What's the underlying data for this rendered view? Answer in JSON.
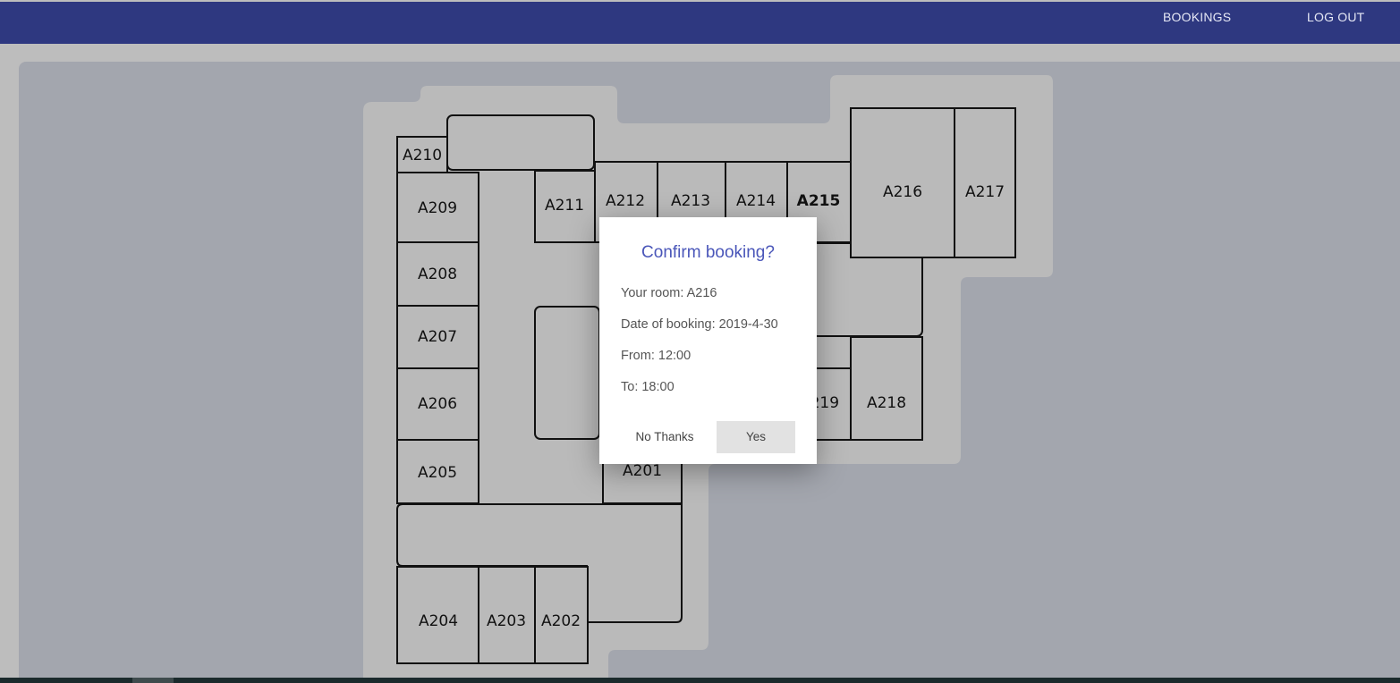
{
  "header": {
    "nav_bookings": "BOOKINGS",
    "nav_logout": "LOG OUT"
  },
  "floorplan": {
    "rooms": {
      "A201": "A201",
      "A202": "A202",
      "A203": "A203",
      "A204": "A204",
      "A205": "A205",
      "A206": "A206",
      "A207": "A207",
      "A208": "A208",
      "A209": "A209",
      "A210": "A210",
      "A211": "A211",
      "A212": "A212",
      "A213": "A213",
      "A214": "A214",
      "A215": "A215",
      "A216": "A216",
      "A217": "A217",
      "A218": "A218",
      "A219": "A219"
    }
  },
  "modal": {
    "title": "Confirm booking?",
    "room_line": "Your room: A216",
    "date_line": "Date of booking: 2019-4-30",
    "from_line": "From: 12:00",
    "to_line": "To: 18:00",
    "no_label": "No Thanks",
    "yes_label": "Yes"
  },
  "colors": {
    "header_bg": "#2e3880",
    "panel_bg": "#a3a6ae",
    "building_bg": "#bababa",
    "modal_title": "#4a56b9"
  }
}
